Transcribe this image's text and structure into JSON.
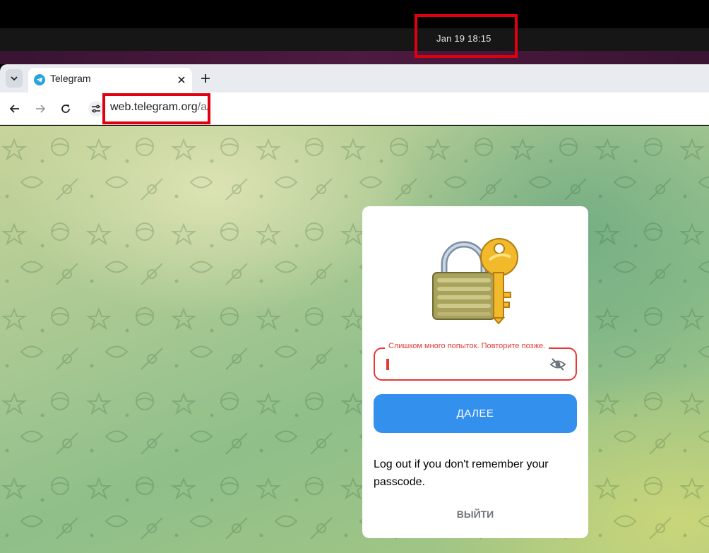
{
  "system_bar": {
    "clock": "Jan 19  18:15"
  },
  "browser": {
    "tab": {
      "title": "Telegram",
      "favicon_icon": "telegram-icon"
    },
    "url": {
      "host": "web.telegram.org",
      "path": "/a/"
    }
  },
  "passcode_screen": {
    "error_label": "Слишком много попыток. Повторите позже.",
    "next_button": "ДАЛЕЕ",
    "hint": "Log out if you don't remember your passcode.",
    "logout_button": "ВЫЙТИ"
  },
  "colors": {
    "accent": "#3390ec",
    "error": "#e53935",
    "highlight": "#e0000f"
  }
}
